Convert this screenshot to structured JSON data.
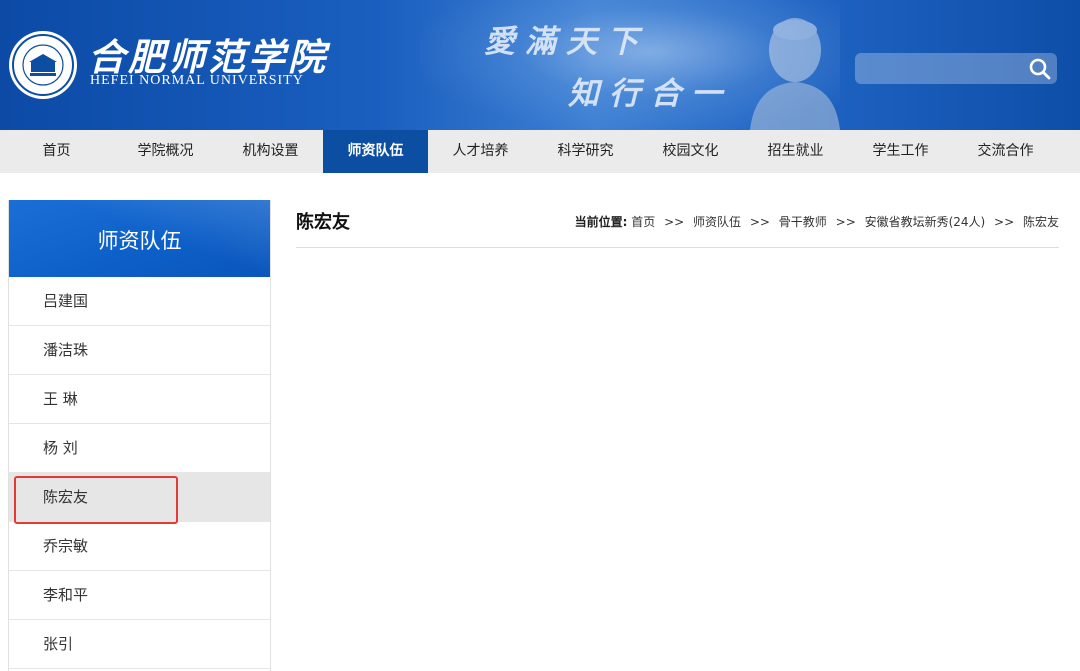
{
  "header": {
    "school_name_cn": "合肥师范学院",
    "school_name_en": "HEFEI NORMAL UNIVERSITY",
    "motto_line1": "愛滿天下",
    "motto_line2": "知行合一",
    "seal_text": "合肥师范学院 HEFEI NORMAL UNIVERSITY",
    "search_placeholder": "",
    "search_icon": "search-icon"
  },
  "nav": {
    "items": [
      {
        "label": "首页"
      },
      {
        "label": "学院概况"
      },
      {
        "label": "机构设置"
      },
      {
        "label": "师资队伍",
        "active": true
      },
      {
        "label": "人才培养"
      },
      {
        "label": "科学研究"
      },
      {
        "label": "校园文化"
      },
      {
        "label": "招生就业"
      },
      {
        "label": "学生工作"
      },
      {
        "label": "交流合作"
      }
    ]
  },
  "sidebar": {
    "title": "师资队伍",
    "items": [
      {
        "label": "吕建国"
      },
      {
        "label": "潘洁珠"
      },
      {
        "label": "王 琳"
      },
      {
        "label": "杨 刘"
      },
      {
        "label": "陈宏友",
        "active": true
      },
      {
        "label": "乔宗敏"
      },
      {
        "label": "李和平"
      },
      {
        "label": "张引"
      }
    ]
  },
  "main": {
    "title": "陈宏友",
    "breadcrumb": {
      "label": "当前位置:",
      "items": [
        "首页",
        "师资队伍",
        "骨干教师",
        "安徽省教坛新秀(24人)",
        "陈宏友"
      ],
      "separator": ">>"
    }
  },
  "colors": {
    "brand_blue": "#0b4ea2",
    "nav_bg": "#ebebeb",
    "highlight_red": "#e53935"
  }
}
